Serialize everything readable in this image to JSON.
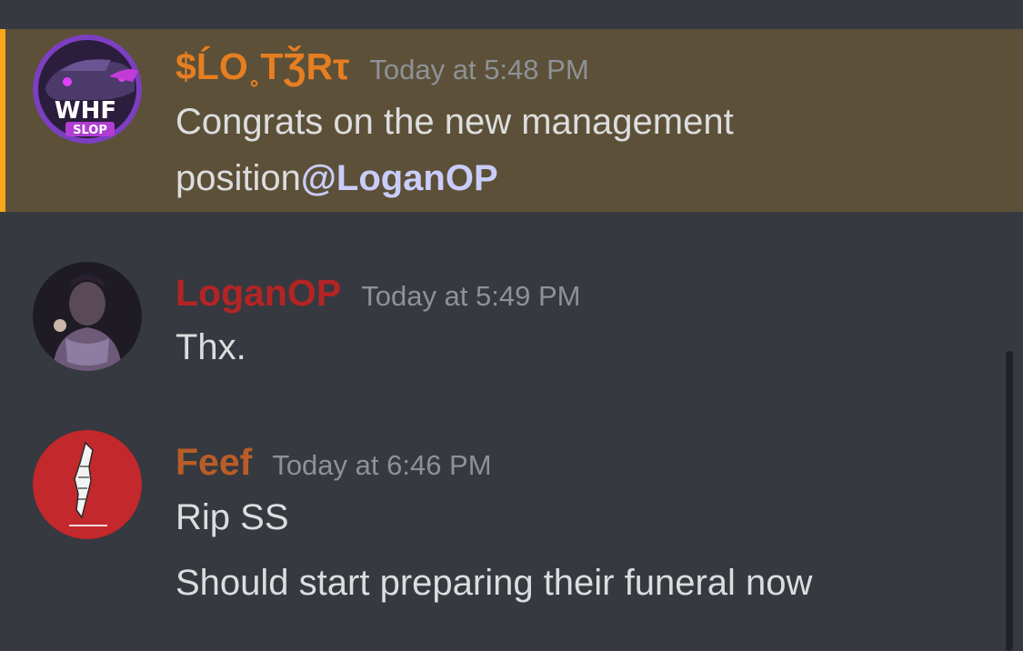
{
  "messages": [
    {
      "author": "$ĹO˳TǮRτ",
      "author_color": "#e67e22",
      "timestamp": "Today at 5:48 PM",
      "avatar_text": "WHF",
      "avatar_sub": "SLOP",
      "lines": [
        "Congrats on the new management"
      ],
      "line2_prefix": "position",
      "mention": "@LoganOP",
      "highlighted": true
    },
    {
      "author": "LoganOP",
      "author_color": "#b42425",
      "timestamp": "Today at 5:49 PM",
      "lines": [
        "Thx."
      ]
    },
    {
      "author": "Feef",
      "author_color": "#b95d27",
      "timestamp": "Today at 6:46 PM",
      "lines": [
        "Rip SS",
        "Should start preparing their funeral now"
      ]
    }
  ],
  "colors": {
    "background": "#36393f",
    "mention_highlight": "#5c5038",
    "mention_bar": "#faa61a",
    "timestamp": "#8e9297",
    "message_text": "#dcddde",
    "mention_text": "#c9cdfb"
  }
}
